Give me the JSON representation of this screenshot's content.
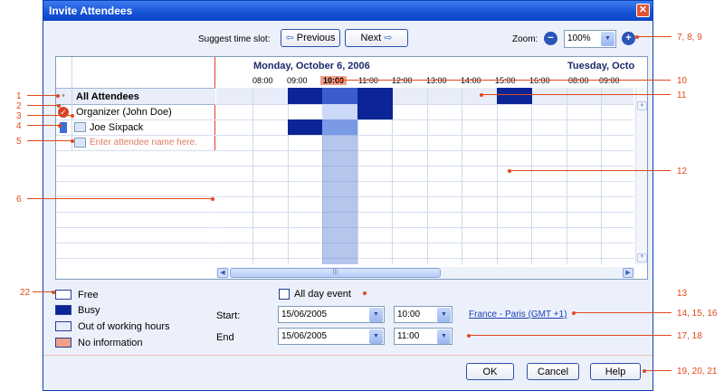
{
  "window": {
    "title": "Invite Attendees",
    "close_icon": "close-icon"
  },
  "toolbar": {
    "suggest_label": "Suggest time slot:",
    "previous_label": "Previous",
    "next_label": "Next",
    "zoom_label": "Zoom:",
    "zoom_value": "100%"
  },
  "schedule": {
    "date_left": "Monday, October 6, 2006",
    "date_right": "Tuesday, Octo",
    "time_labels": [
      "08:00",
      "09:00",
      "10:00",
      "11:00",
      "12:00",
      "13:00",
      "14:00",
      "15:00",
      "16:00",
      "08:00",
      "09:00"
    ],
    "selected_time": "10:00"
  },
  "attendees": {
    "header": "All Attendees",
    "organizer": "Organizer (John Doe)",
    "attendee": "Joe Sixpack",
    "placeholder": "Enter attendee name here."
  },
  "legend": {
    "free": "Free",
    "busy": "Busy",
    "out": "Out of working hours",
    "noinfo": "No information"
  },
  "form": {
    "all_day_label": "All day event",
    "start_label": "Start:",
    "end_label": "End",
    "start_date": "15/06/2005",
    "start_time": "10:00",
    "end_date": "15/06/2005",
    "end_time": "11:00",
    "timezone": "France - Paris (GMT +1)"
  },
  "buttons": {
    "ok": "OK",
    "cancel": "Cancel",
    "help": "Help"
  },
  "callouts": [
    "1",
    "2",
    "3",
    "4",
    "5",
    "6",
    "7, 8, 9",
    "10",
    "11",
    "12",
    "13",
    "14, 15, 16",
    "17, 18",
    "19, 20, 21",
    "22"
  ],
  "colors": {
    "busy": "#0c2596",
    "accent": "#e0491d",
    "title": "#1452d6",
    "noinfo": "#f0a08a"
  }
}
